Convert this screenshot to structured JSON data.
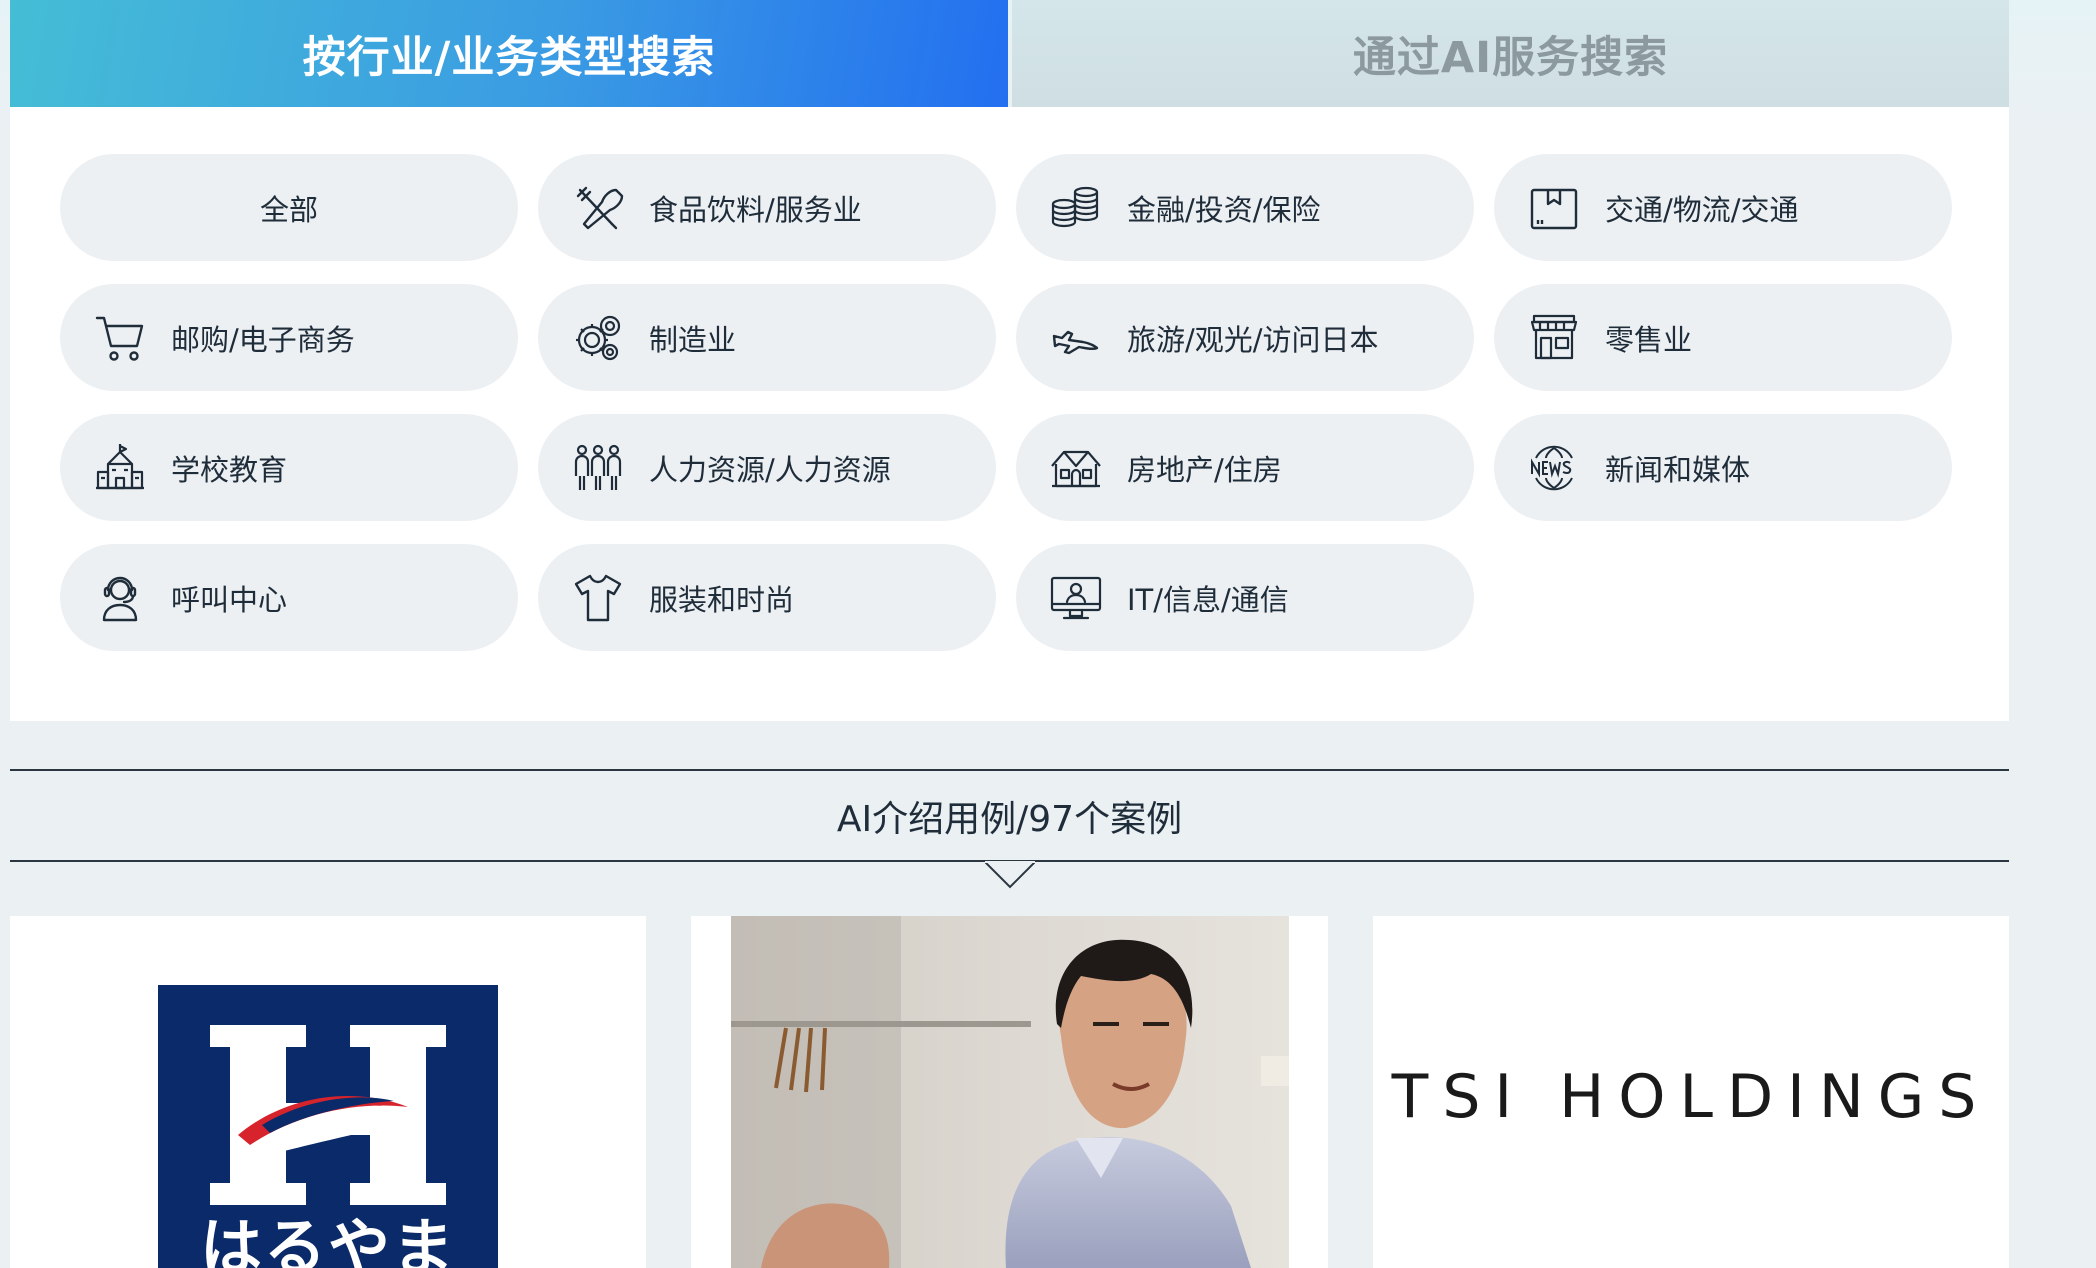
{
  "tabs": [
    {
      "label": "按行业/业务类型搜索",
      "active": true
    },
    {
      "label": "通过AI服务搜索",
      "active": false
    }
  ],
  "industries": [
    {
      "label": "全部",
      "icon": null
    },
    {
      "label": "食品饮料/服务业",
      "icon": "fork-knife-icon"
    },
    {
      "label": "金融/投资/保险",
      "icon": "coin-stack-icon"
    },
    {
      "label": "交通/物流/交通",
      "icon": "box-icon"
    },
    {
      "label": "邮购/电子商务",
      "icon": "cart-icon"
    },
    {
      "label": "制造业",
      "icon": "gears-icon"
    },
    {
      "label": "旅游/观光/访问日本",
      "icon": "airplane-icon"
    },
    {
      "label": "零售业",
      "icon": "storefront-icon"
    },
    {
      "label": "学校教育",
      "icon": "school-icon"
    },
    {
      "label": "人力资源/人力资源",
      "icon": "people-icon"
    },
    {
      "label": "房地产/住房",
      "icon": "house-icon"
    },
    {
      "label": "新闻和媒体",
      "icon": "news-globe-icon"
    },
    {
      "label": "呼叫中心",
      "icon": "headset-icon"
    },
    {
      "label": "服装和时尚",
      "icon": "tshirt-icon"
    },
    {
      "label": "IT/信息/通信",
      "icon": "monitor-icon"
    }
  ],
  "cases": {
    "title": "AI介绍用例/97个案例",
    "cards": [
      {
        "logo_text": "はるやま",
        "type": "logo"
      },
      {
        "type": "photo"
      },
      {
        "logo_text": "TSI HOLDINGS",
        "type": "text-logo"
      }
    ]
  },
  "colors": {
    "tab_active_start": "#45bdd6",
    "tab_active_end": "#236ff0",
    "pill_bg": "#edf0f3",
    "haruyama_navy": "#0b2a6a",
    "haruyama_red": "#d7232b"
  }
}
